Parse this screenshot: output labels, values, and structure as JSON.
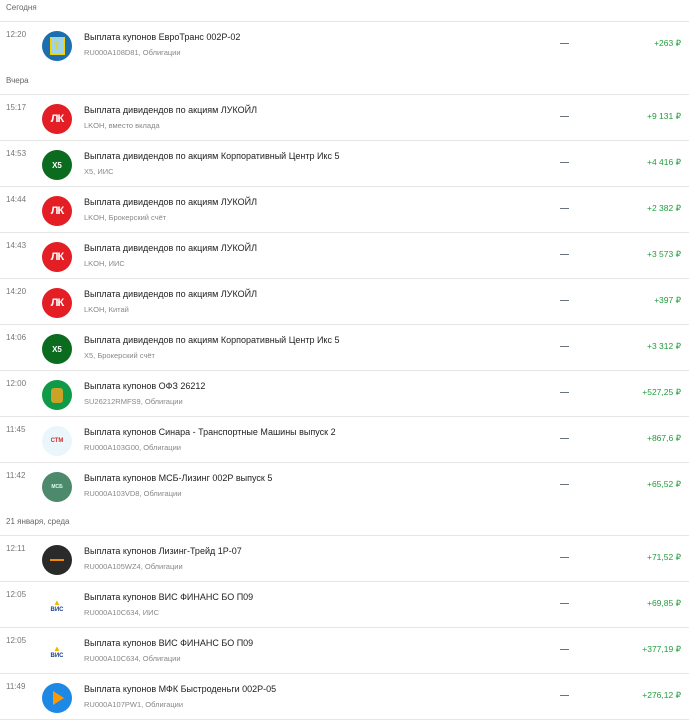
{
  "colors": {
    "positive": "#1f9d3a",
    "divider": "#e6e6e6"
  },
  "groups": [
    {
      "label": "Сегодня",
      "items": [
        {
          "time": "12:20",
          "title": "Выплата купонов ЕвроТранс 002Р-02",
          "subtitle": "RU000A108D81, Облигации",
          "status": "—",
          "amount": "+263 ₽",
          "logo": "eurotrans-logo"
        }
      ]
    },
    {
      "label": "Вчера",
      "items": [
        {
          "time": "15:17",
          "title": "Выплата дивидендов по акциям ЛУКОЙЛ",
          "subtitle": "LKOH, вместо вклада",
          "status": "—",
          "amount": "+9 131 ₽",
          "logo": "lukoil-logo"
        },
        {
          "time": "14:53",
          "title": "Выплата дивидендов по акциям Корпоративный Центр Икс 5",
          "subtitle": "X5, ИИС",
          "status": "—",
          "amount": "+4 416 ₽",
          "logo": "x5-logo"
        },
        {
          "time": "14:44",
          "title": "Выплата дивидендов по акциям ЛУКОЙЛ",
          "subtitle": "LKOH, Брокерский счёт",
          "status": "—",
          "amount": "+2 382 ₽",
          "logo": "lukoil-logo"
        },
        {
          "time": "14:43",
          "title": "Выплата дивидендов по акциям ЛУКОЙЛ",
          "subtitle": "LKOH, ИИС",
          "status": "—",
          "amount": "+3 573 ₽",
          "logo": "lukoil-logo"
        },
        {
          "time": "14:20",
          "title": "Выплата дивидендов по акциям ЛУКОЙЛ",
          "subtitle": "LKOH, Китай",
          "status": "—",
          "amount": "+397 ₽",
          "logo": "lukoil-logo"
        },
        {
          "time": "14:06",
          "title": "Выплата дивидендов по акциям Корпоративный Центр Икс 5",
          "subtitle": "X5, Брокерский счёт",
          "status": "—",
          "amount": "+3 312 ₽",
          "logo": "x5-logo"
        },
        {
          "time": "12:00",
          "title": "Выплата купонов ОФЗ 26212",
          "subtitle": "SU26212RMFS9, Облигации",
          "status": "—",
          "amount": "+527,25 ₽",
          "logo": "minfin-logo"
        },
        {
          "time": "11:45",
          "title": "Выплата купонов Синара - Транспортные Машины выпуск 2",
          "subtitle": "RU000A103G00, Облигации",
          "status": "—",
          "amount": "+867,6 ₽",
          "logo": "stm-logo"
        },
        {
          "time": "11:42",
          "title": "Выплата купонов МСБ-Лизинг 002Р выпуск 5",
          "subtitle": "RU000A103VD8, Облигации",
          "status": "—",
          "amount": "+65,52 ₽",
          "logo": "msb-logo"
        }
      ]
    },
    {
      "label": "21 января, среда",
      "items": [
        {
          "time": "12:11",
          "title": "Выплата купонов Лизинг-Трейд 1Р-07",
          "subtitle": "RU000A105WZ4, Облигации",
          "status": "—",
          "amount": "+71,52 ₽",
          "logo": "leasing-trade-logo"
        },
        {
          "time": "12:05",
          "title": "Выплата купонов ВИС ФИНАНС БО П09",
          "subtitle": "RU000A10C634, ИИС",
          "status": "—",
          "amount": "+69,85 ₽",
          "logo": "vis-logo"
        },
        {
          "time": "12:05",
          "title": "Выплата купонов ВИС ФИНАНС БО П09",
          "subtitle": "RU000A10C634, Облигации",
          "status": "—",
          "amount": "+377,19 ₽",
          "logo": "vis-logo"
        },
        {
          "time": "11:49",
          "title": "Выплата купонов МФК Быстроденьги 002Р-05",
          "subtitle": "RU000A107PW1, Облигации",
          "status": "—",
          "amount": "+276,12 ₽",
          "logo": "bystrodengi-logo"
        }
      ]
    }
  ]
}
